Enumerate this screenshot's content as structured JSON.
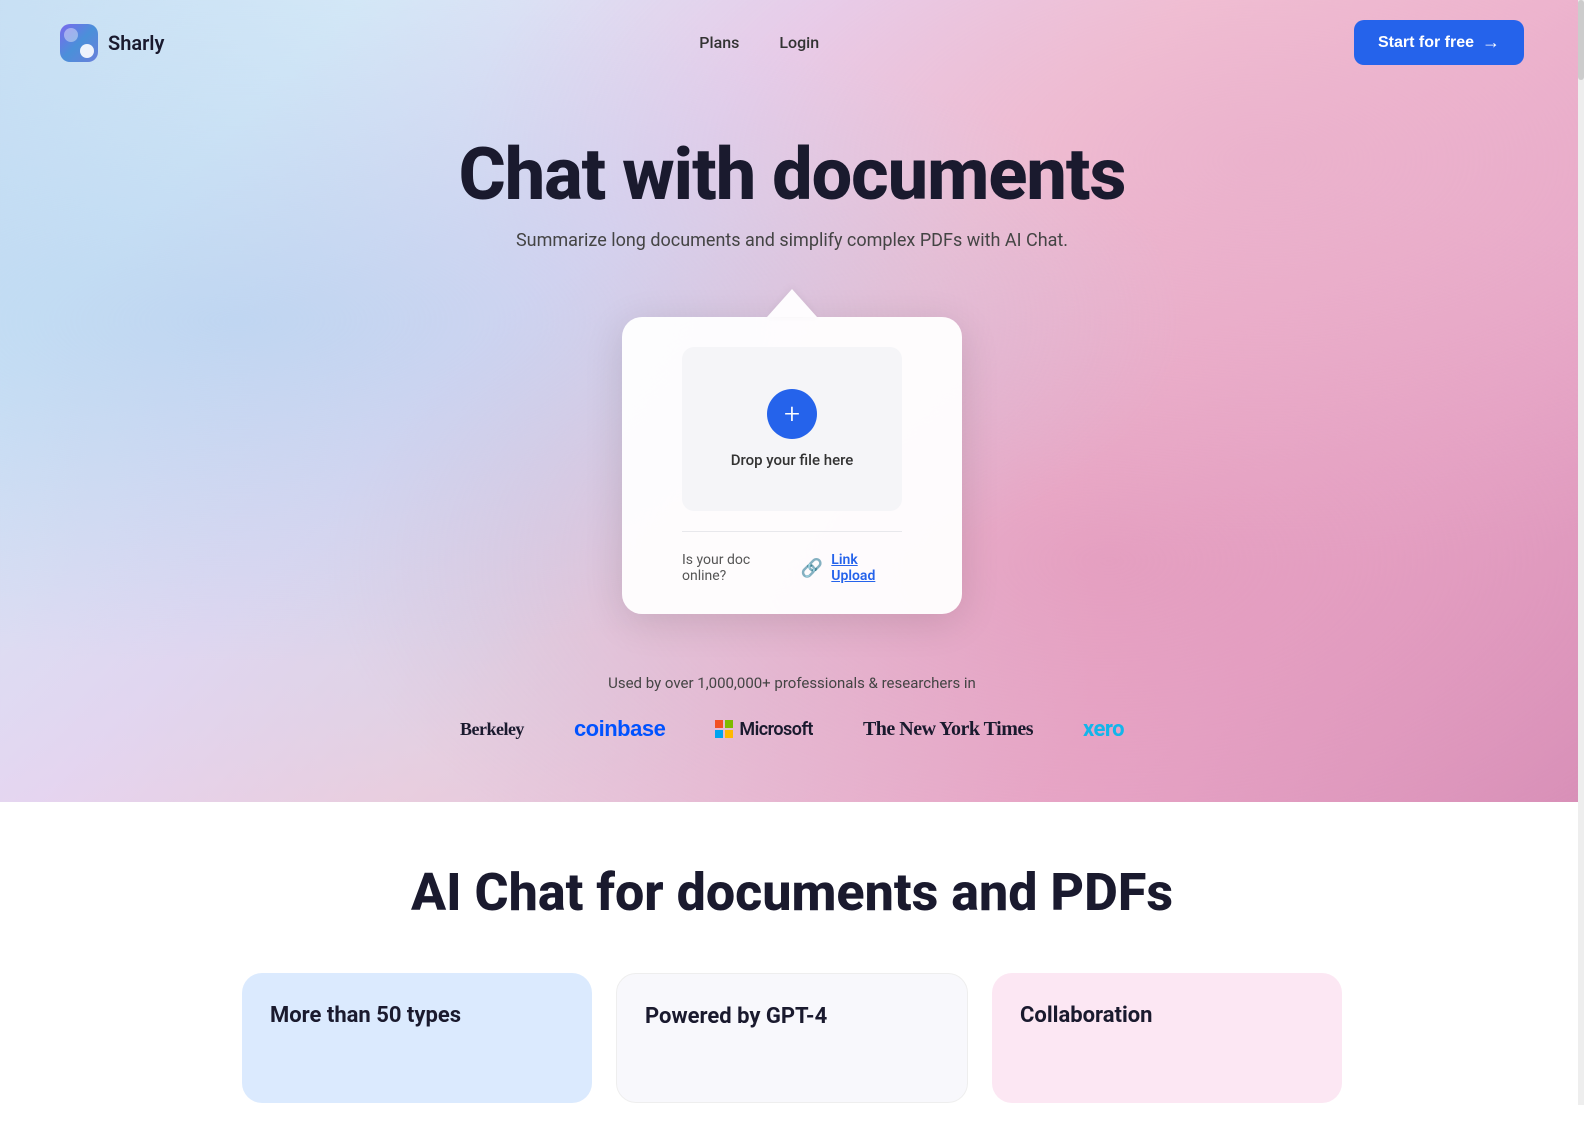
{
  "navbar": {
    "logo_text": "Sharly",
    "nav_links": [
      {
        "label": "Plans",
        "id": "plans"
      },
      {
        "label": "Login",
        "id": "login"
      }
    ],
    "cta_button": "Start for free"
  },
  "hero": {
    "title": "Chat with documents",
    "subtitle": "Summarize long documents and simplify complex PDFs with AI Chat."
  },
  "upload_card": {
    "drop_text": "Drop your file here",
    "online_doc_label": "Is your doc online?",
    "link_upload_label": "Link Upload"
  },
  "social_proof": {
    "text": "Used by over 1,000,000+ professionals & researchers in",
    "logos": [
      {
        "name": "Berkeley",
        "type": "berkeley"
      },
      {
        "name": "coinbase",
        "type": "coinbase"
      },
      {
        "name": "Microsoft",
        "type": "microsoft"
      },
      {
        "name": "The New York Times",
        "type": "nyt"
      },
      {
        "name": "xero",
        "type": "xero"
      }
    ]
  },
  "bottom_section": {
    "title": "AI Chat for documents and PDFs",
    "cards": [
      {
        "title": "More than 50 types",
        "bg": "blue"
      },
      {
        "title": "Powered by GPT-4",
        "bg": "white"
      },
      {
        "title": "Collaboration",
        "bg": "pink"
      }
    ]
  }
}
